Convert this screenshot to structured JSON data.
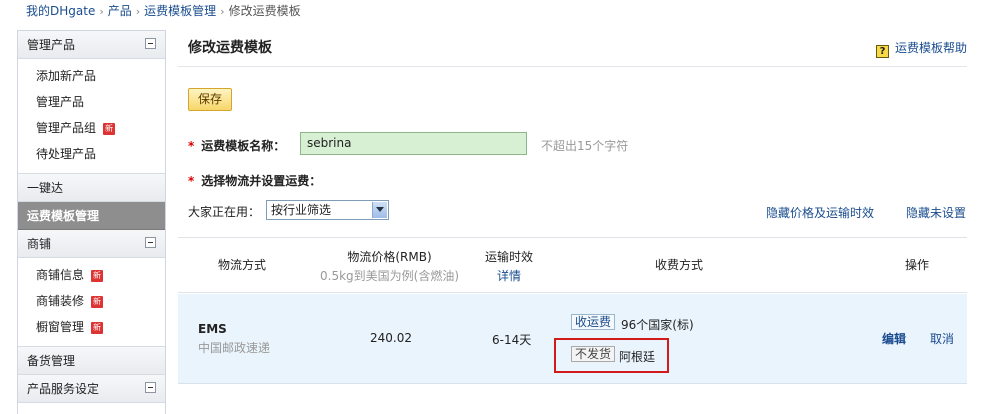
{
  "breadcrumb": [
    "我的DHgate",
    "产品",
    "运费模板管理",
    "修改运费模板"
  ],
  "sidebar": {
    "section1_title": "管理产品",
    "section1_items": [
      {
        "label": "添加新产品",
        "new": false
      },
      {
        "label": "管理产品",
        "new": false
      },
      {
        "label": "管理产品组",
        "new": true,
        "badge": "新"
      },
      {
        "label": "待处理产品",
        "new": false
      }
    ],
    "item_yijianda": "一键达",
    "active_item": "运费模板管理",
    "section2_title": "商铺",
    "section2_items": [
      {
        "label": "商铺信息",
        "new": true,
        "badge": "新"
      },
      {
        "label": "商铺装修",
        "new": true,
        "badge": "新"
      },
      {
        "label": "橱窗管理",
        "new": true,
        "badge": "新"
      }
    ],
    "item_stock": "备货管理",
    "section3_title": "产品服务设定"
  },
  "main": {
    "title": "修改运费模板",
    "help_label": "运费模板帮助",
    "help_glyph": "?",
    "save_label": "保存",
    "name_label": "运费模板名称：",
    "name_value": "sebrina",
    "name_hint": "不超出15个字符",
    "logistics_label": "选择物流并设置运费：",
    "popular_label": "大家正在用：",
    "filter_selected": "按行业筛选",
    "hide_price_link": "隐藏价格及运输时效",
    "hide_unset_link": "隐藏未设置"
  },
  "table": {
    "col_method": "物流方式",
    "col_price": "物流价格(RMB)",
    "col_price_sub": "0.5kg到美国为例(含燃油)",
    "col_time": "运输时效",
    "col_time_link": "详情",
    "col_fee": "收费方式",
    "col_ops": "操作",
    "rows": [
      {
        "name": "EMS",
        "sub": "中国邮政速递",
        "price": "240.02",
        "days": "6-14天",
        "charge_tag": "收运费",
        "charge_text": "96个国家(标)",
        "nosend_tag": "不发货",
        "nosend_text": "阿根廷",
        "edit": "编辑",
        "cancel": "取消"
      }
    ]
  },
  "colors": {
    "link": "#1a4c8f",
    "required": "#dd0000",
    "highlight_box": "#d21a1a",
    "row_bg": "#eaf4fc",
    "input_bg": "#d7f0d4",
    "active_sidebar": "#8e8e8e"
  },
  "icons": [
    "help-icon",
    "collapse-icon",
    "new-badge",
    "dropdown-arrow-icon"
  ]
}
